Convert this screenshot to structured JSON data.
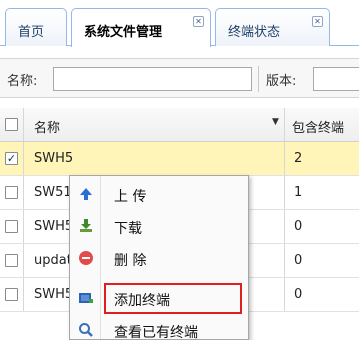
{
  "tabs": [
    {
      "label": "首页",
      "closable": false,
      "active": false
    },
    {
      "label": "系统文件管理",
      "closable": true,
      "active": true
    },
    {
      "label": "终端状态",
      "closable": true,
      "active": false
    }
  ],
  "tab_close_glyph": "✕",
  "search": {
    "name_label": "名称:",
    "name_value": "",
    "version_label": "版本:",
    "version_value": ""
  },
  "grid": {
    "columns": [
      "名称",
      "包含终端"
    ],
    "rows": [
      {
        "name": "SWH5",
        "count": "2",
        "checked": true
      },
      {
        "name": "SW51",
        "count": "1",
        "checked": false
      },
      {
        "name": "SWH5",
        "count": "0",
        "checked": false
      },
      {
        "name": "update",
        "count": "0",
        "checked": false
      },
      {
        "name": "SWH5",
        "count": "0",
        "checked": false
      }
    ]
  },
  "context_menu": {
    "items": [
      {
        "label": "上 传",
        "icon": "upload-arrow-icon"
      },
      {
        "label": "下载",
        "icon": "download-icon"
      },
      {
        "label": "删 除",
        "icon": "delete-circle-icon"
      },
      {
        "label": "添加终端",
        "icon": "add-terminal-icon"
      },
      {
        "label": "查看已有终端",
        "icon": "magnifier-icon"
      }
    ],
    "highlighted_index": 3
  },
  "colors": {
    "tab_border": "#95b8e7",
    "selected_row": "#fff5b8",
    "highlight_box": "#e02020"
  }
}
